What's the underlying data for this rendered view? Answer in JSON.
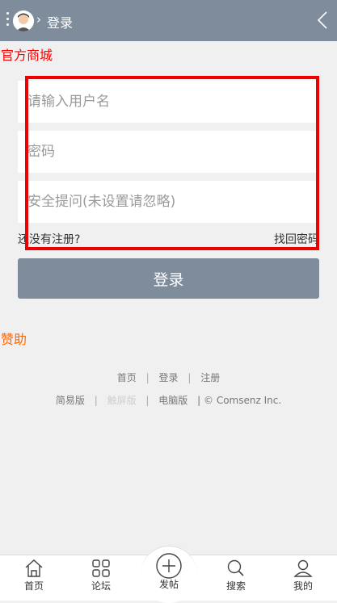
{
  "header": {
    "separator": "›",
    "title": "登录"
  },
  "site_title": "官方商城",
  "form": {
    "username_placeholder": "请输入用户名",
    "password_placeholder": "密码",
    "question_placeholder": "安全提问(未设置请忽略)",
    "register_link": "还没有注册?",
    "forgot_link": "找回密码",
    "login_button": "登录"
  },
  "sponsor": "赞助",
  "footer": {
    "links": [
      "首页",
      "登录",
      "注册"
    ],
    "versions": [
      "简易版",
      "触屏版",
      "电脑版"
    ],
    "copyright": "| © Comsenz Inc.",
    "divider": "|"
  },
  "bottom_nav": [
    {
      "label": "首页",
      "icon": "home-icon"
    },
    {
      "label": "论坛",
      "icon": "grid-icon"
    },
    {
      "label": "发帖",
      "icon": "plus-circle-icon"
    },
    {
      "label": "搜索",
      "icon": "search-icon"
    },
    {
      "label": "我的",
      "icon": "user-icon"
    }
  ],
  "colors": {
    "header_bg": "#7e8c9c",
    "title_red": "#ff0000",
    "sponsor_orange": "#ff6600",
    "highlight_box": "#ee0000"
  }
}
